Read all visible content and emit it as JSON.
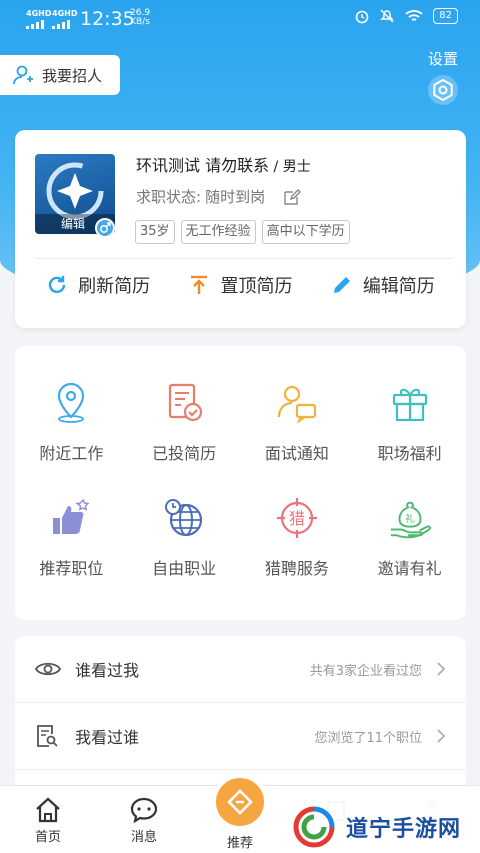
{
  "status_bar": {
    "network_1": "4GHD",
    "network_2": "4GHD",
    "time": "12:35",
    "speed_value": "26.9",
    "speed_unit": "KB/s",
    "battery": "82"
  },
  "header": {
    "recruit_label": "我要招人",
    "settings_label": "设置"
  },
  "profile": {
    "name": "环讯测试 请勿联系",
    "separator": " / ",
    "gender": "男士",
    "status_label": "求职状态:",
    "status_value": "随时到岗",
    "avatar_edit": "编辑",
    "tags": [
      "35岁",
      "无工作经验",
      "高中以下学历"
    ]
  },
  "actions": {
    "refresh": "刷新简历",
    "top": "置顶简历",
    "edit": "编辑简历"
  },
  "grid": [
    {
      "label": "附近工作",
      "icon": "location-pin-icon"
    },
    {
      "label": "已投简历",
      "icon": "resume-check-icon"
    },
    {
      "label": "面试通知",
      "icon": "interview-chat-icon"
    },
    {
      "label": "职场福利",
      "icon": "gift-icon"
    },
    {
      "label": "推荐职位",
      "icon": "thumbs-up-star-icon"
    },
    {
      "label": "自由职业",
      "icon": "globe-clock-icon"
    },
    {
      "label": "猎聘服务",
      "icon": "hunt-target-icon"
    },
    {
      "label": "邀请有礼",
      "icon": "money-bag-hand-icon"
    }
  ],
  "grid_extra": {
    "hunt_char": "猎",
    "gift_char": "礼"
  },
  "list": [
    {
      "title": "谁看过我",
      "desc": "共有3家企业看过您"
    },
    {
      "title": "我看过谁",
      "desc": "您浏览了11个职位"
    }
  ],
  "tabbar": {
    "home": "首页",
    "messages": "消息",
    "recommend": "推荐"
  },
  "watermark": {
    "text": "道宁手游网"
  },
  "colors": {
    "header_blue": "#2aa4ef",
    "accent_orange": "#f6a640",
    "icon_blue": "#4aa8e8"
  }
}
